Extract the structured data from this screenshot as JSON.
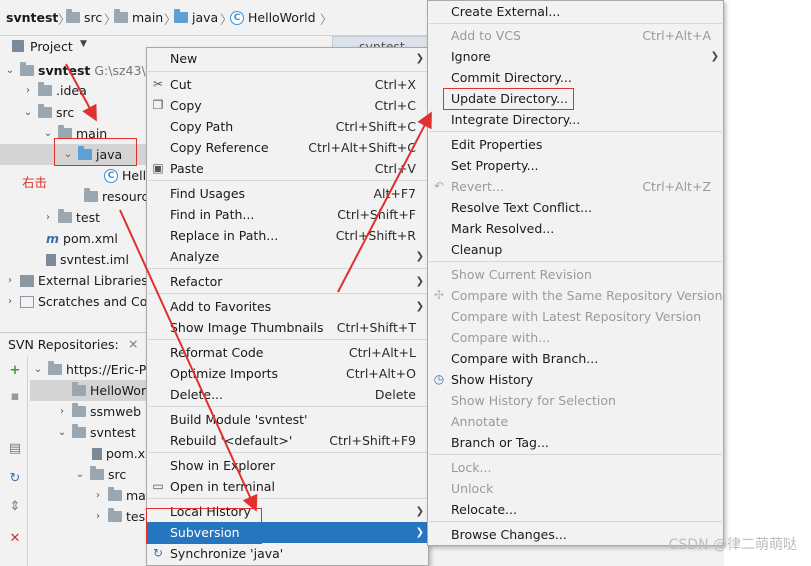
{
  "breadcrumb": {
    "project": "svntest",
    "items": [
      "src",
      "main",
      "java",
      "HelloWorld"
    ]
  },
  "project_panel": {
    "title": "Project",
    "tree": [
      {
        "label": "svntest",
        "extra": "G:\\sz43\\s"
      },
      {
        "label": ".idea"
      },
      {
        "label": "src"
      },
      {
        "label": "main"
      },
      {
        "label": "java"
      },
      {
        "label": "Hell"
      },
      {
        "label": "resourc"
      },
      {
        "label": "test"
      },
      {
        "label": "pom.xml"
      },
      {
        "label": "svntest.iml"
      },
      {
        "label": "External Libraries"
      },
      {
        "label": "Scratches and Cor"
      }
    ],
    "annotation": "右击",
    "editor_tab": "svntest"
  },
  "svn_panel": {
    "title": "SVN Repositories:",
    "close": "×",
    "tree": [
      {
        "label": "https://Eric-P"
      },
      {
        "label": "HelloWor"
      },
      {
        "label": "ssmweb"
      },
      {
        "label": "svntest"
      },
      {
        "label": "pom.x"
      },
      {
        "label": "src"
      },
      {
        "label": "ma"
      },
      {
        "label": "tes"
      }
    ]
  },
  "context_menu": {
    "items": [
      {
        "label": "New",
        "shortcut": ""
      },
      {
        "label": "Cut",
        "shortcut": "Ctrl+X"
      },
      {
        "label": "Copy",
        "shortcut": "Ctrl+C"
      },
      {
        "label": "Copy Path",
        "shortcut": "Ctrl+Shift+C"
      },
      {
        "label": "Copy Reference",
        "shortcut": "Ctrl+Alt+Shift+C"
      },
      {
        "label": "Paste",
        "shortcut": "Ctrl+V"
      },
      {
        "label": "Find Usages",
        "shortcut": "Alt+F7"
      },
      {
        "label": "Find in Path...",
        "shortcut": "Ctrl+Shift+F"
      },
      {
        "label": "Replace in Path...",
        "shortcut": "Ctrl+Shift+R"
      },
      {
        "label": "Analyze",
        "shortcut": ""
      },
      {
        "label": "Refactor",
        "shortcut": ""
      },
      {
        "label": "Add to Favorites",
        "shortcut": ""
      },
      {
        "label": "Show Image Thumbnails",
        "shortcut": "Ctrl+Shift+T"
      },
      {
        "label": "Reformat Code",
        "shortcut": "Ctrl+Alt+L"
      },
      {
        "label": "Optimize Imports",
        "shortcut": "Ctrl+Alt+O"
      },
      {
        "label": "Delete...",
        "shortcut": "Delete"
      },
      {
        "label": "Build Module 'svntest'",
        "shortcut": ""
      },
      {
        "label": "Rebuild '<default>'",
        "shortcut": "Ctrl+Shift+F9"
      },
      {
        "label": "Show in Explorer",
        "shortcut": ""
      },
      {
        "label": "Open in terminal",
        "shortcut": ""
      },
      {
        "label": "Local History",
        "shortcut": ""
      },
      {
        "label": "Subversion",
        "shortcut": ""
      },
      {
        "label": "Synchronize 'java'",
        "shortcut": ""
      }
    ]
  },
  "submenu": {
    "items": [
      {
        "label": "Create External...",
        "shortcut": ""
      },
      {
        "label": "Add to VCS",
        "shortcut": "Ctrl+Alt+A"
      },
      {
        "label": "Ignore",
        "shortcut": ""
      },
      {
        "label": "Commit Directory...",
        "shortcut": ""
      },
      {
        "label": "Update Directory...",
        "shortcut": ""
      },
      {
        "label": "Integrate Directory...",
        "shortcut": ""
      },
      {
        "label": "Edit Properties",
        "shortcut": ""
      },
      {
        "label": "Set Property...",
        "shortcut": ""
      },
      {
        "label": "Revert...",
        "shortcut": "Ctrl+Alt+Z"
      },
      {
        "label": "Resolve Text Conflict...",
        "shortcut": ""
      },
      {
        "label": "Mark Resolved...",
        "shortcut": ""
      },
      {
        "label": "Cleanup",
        "shortcut": ""
      },
      {
        "label": "Show Current Revision",
        "shortcut": ""
      },
      {
        "label": "Compare with the Same Repository Version",
        "shortcut": ""
      },
      {
        "label": "Compare with Latest Repository Version",
        "shortcut": ""
      },
      {
        "label": "Compare with...",
        "shortcut": ""
      },
      {
        "label": "Compare with Branch...",
        "shortcut": ""
      },
      {
        "label": "Show History",
        "shortcut": ""
      },
      {
        "label": "Show History for Selection",
        "shortcut": ""
      },
      {
        "label": "Annotate",
        "shortcut": ""
      },
      {
        "label": "Branch or Tag...",
        "shortcut": ""
      },
      {
        "label": "Lock...",
        "shortcut": ""
      },
      {
        "label": "Unlock",
        "shortcut": ""
      },
      {
        "label": "Relocate...",
        "shortcut": ""
      },
      {
        "label": "Browse Changes...",
        "shortcut": ""
      }
    ]
  },
  "watermark": "CSDN @律二萌萌哒",
  "colors": {
    "highlight": "#2675bf",
    "annotation": "#e03030",
    "disabled": "#9a9a9a"
  }
}
